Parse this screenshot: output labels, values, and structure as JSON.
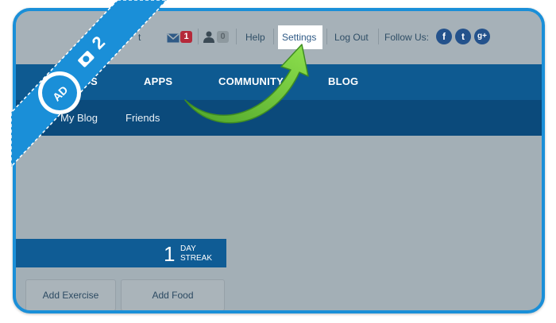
{
  "topbar": {
    "partial_text": "t",
    "messages_count": "1",
    "friends_count": "0",
    "help": "Help",
    "settings": "Settings",
    "logout": "Log Out",
    "follow_us": "Follow Us:",
    "social": {
      "facebook": "f",
      "twitter": "t",
      "googleplus": "g+"
    }
  },
  "mainnav": {
    "partial_item": "S",
    "apps": "APPS",
    "community": "COMMUNITY",
    "blog": "BLOG"
  },
  "subnav": {
    "my_blog": "My Blog",
    "friends": "Friends"
  },
  "streak": {
    "count": "1",
    "label_top": "DAY",
    "label_bottom": "STREAK"
  },
  "actions": {
    "add_exercise": "Add Exercise",
    "add_food": "Add Food"
  },
  "overlay": {
    "step_number": "2"
  },
  "colors": {
    "frame": "#1a8fd8",
    "nav": "#0e5a91",
    "subnav": "#0b4a7b",
    "arrow": "#6cc83a"
  }
}
